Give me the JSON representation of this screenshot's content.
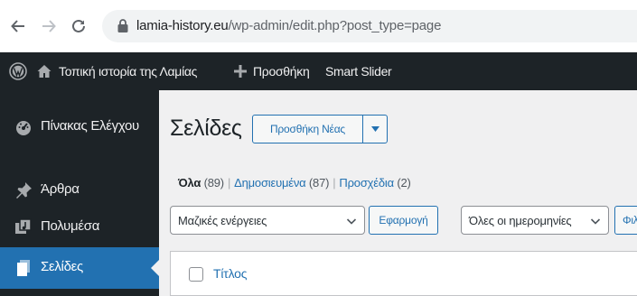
{
  "browser": {
    "url_domain": "lamia-history.eu",
    "url_path": "/wp-admin/edit.php?post_type=page",
    "icons": [
      "back-arrow-icon",
      "forward-arrow-icon",
      "reload-icon",
      "lock-icon"
    ]
  },
  "admin_bar": {
    "site_name": "Τοπική ιστορία της Λαμίας",
    "new_label": "Προσθήκη",
    "slider_label": "Smart Slider",
    "icons": [
      "wordpress-logo-icon",
      "home-icon",
      "plus-icon"
    ]
  },
  "sidebar": {
    "items": [
      {
        "label": "Πίνακας Ελέγχου",
        "icon": "dashboard-icon"
      },
      {
        "label": "Άρθρα",
        "icon": "pin-icon"
      },
      {
        "label": "Πολυμέσα",
        "icon": "media-icon"
      },
      {
        "label": "Σελίδες",
        "icon": "page-icon",
        "current": true
      }
    ]
  },
  "main": {
    "title": "Σελίδες",
    "add_new_label": "Προσθήκη Νέας",
    "filters": {
      "all_label": "Όλα",
      "all_count": "(89)",
      "published_label": "Δημοσιευμένα",
      "published_count": "(87)",
      "drafts_label": "Προσχέδια",
      "drafts_count": "(2)",
      "separator": "|"
    },
    "bulk_actions_value": "Μαζικές ενέργειες",
    "apply_label": "Εφαρμογή",
    "dates_value": "Όλες οι ημερομηνίες",
    "filter_label": "Φιλτράρισμα",
    "table": {
      "title_column": "Τίτλος"
    }
  },
  "colors": {
    "admin_dark": "#1d2327",
    "accent": "#2271b1",
    "background": "#f0f0f1"
  }
}
